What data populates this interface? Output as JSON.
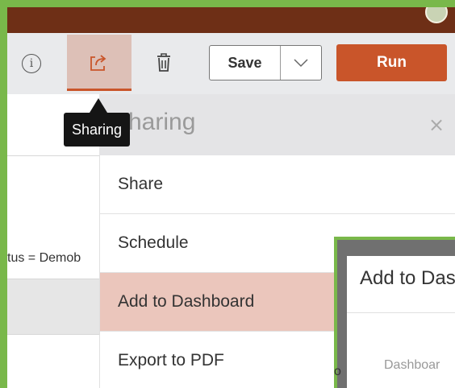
{
  "toolbar": {
    "info_icon": "info-circle-icon",
    "share_icon": "share-export-icon",
    "trash_icon": "trash-icon",
    "save_label": "Save",
    "save_caret_icon": "chevron-down-icon",
    "run_label": "Run",
    "accent_color": "#c9552a",
    "topbar_color": "#6e2f16"
  },
  "tooltip": {
    "text": "Sharing"
  },
  "left_panel": {
    "filter_text": "tus = Demob"
  },
  "sharing_panel": {
    "title": "haring",
    "close_icon": "close-icon",
    "items": [
      {
        "label": "Share"
      },
      {
        "label": "Schedule"
      },
      {
        "label": "Add to Dashboard",
        "active": true
      },
      {
        "label": "Export to PDF"
      }
    ]
  },
  "add_dialog": {
    "title": "Add to Das",
    "field_label": "Dashboar",
    "peek": "o"
  }
}
